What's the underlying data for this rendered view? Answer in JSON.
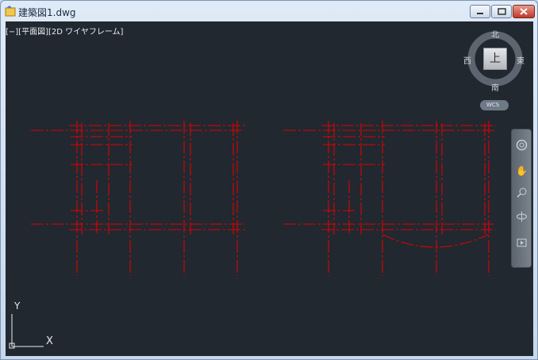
{
  "window": {
    "title": "建築図1.dwg",
    "buttons": [
      "minimize",
      "maximize",
      "close"
    ]
  },
  "viewport": {
    "label": "[−][平面図][2D ワイヤフレーム]",
    "background": "#212830",
    "drawing_color": "#e00000"
  },
  "viewcube": {
    "north": "北",
    "south": "南",
    "east": "東",
    "west": "西",
    "face": "上",
    "wcs_label": "WCS"
  },
  "navbar": {
    "tools": [
      "full-navigation-wheel-icon",
      "pan-icon",
      "zoom-icon",
      "orbit-icon",
      "showmotion-icon"
    ]
  },
  "ucs": {
    "x_label": "X",
    "y_label": "Y"
  }
}
